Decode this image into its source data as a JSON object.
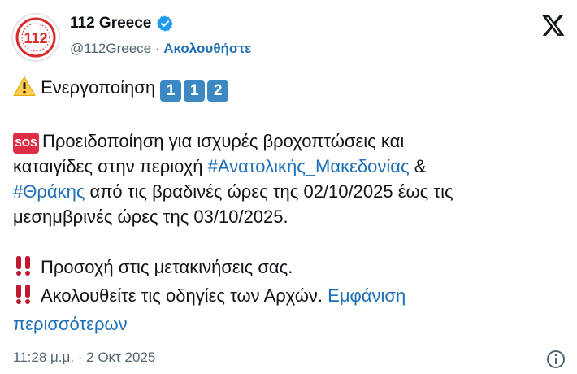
{
  "header": {
    "avatar_text": "112",
    "display_name": "112 Greece",
    "handle": "@112Greece",
    "separator": " · ",
    "follow_label": "Ακολουθήστε"
  },
  "tweet": {
    "activation": {
      "text": "Ενεργοποίηση",
      "keys": [
        "1",
        "1",
        "2"
      ]
    },
    "alert": {
      "sos_label": "SOS",
      "line1": "Προειδοποίηση για ισχυρές βροχοπτώσεις και",
      "line2_prefix": "καταιγίδες στην περιοχή ",
      "hashtag1": "#Ανατολικής_Μακεδονίας",
      "line2_suffix": " &",
      "hashtag2": "#Θράκης",
      "line3_suffix": " από τις βραδινές ώρες της 02/10/2025 έως τις",
      "line4": "μεσημβρινές ώρες της 03/10/2025."
    },
    "warnings": [
      "Προσοχή στις μετακινήσεις σας.",
      "Ακολουθείτε τις οδηγίες των Αρχών."
    ],
    "show_more_part1": "Εμφάνιση",
    "show_more_part2": "περισσότερων"
  },
  "footer": {
    "timestamp": "11:28 μ.μ. · 2 Οκτ 2025"
  },
  "colors": {
    "link": "#1d6fb8",
    "secondary_text": "#536471",
    "verified": "#1d9bf0",
    "brand_red": "#d92b2b"
  },
  "icons": [
    "verified-badge-icon",
    "x-logo-icon",
    "warning-icon",
    "keycap-icon",
    "sos-icon",
    "double-exclamation-icon",
    "info-icon"
  ]
}
